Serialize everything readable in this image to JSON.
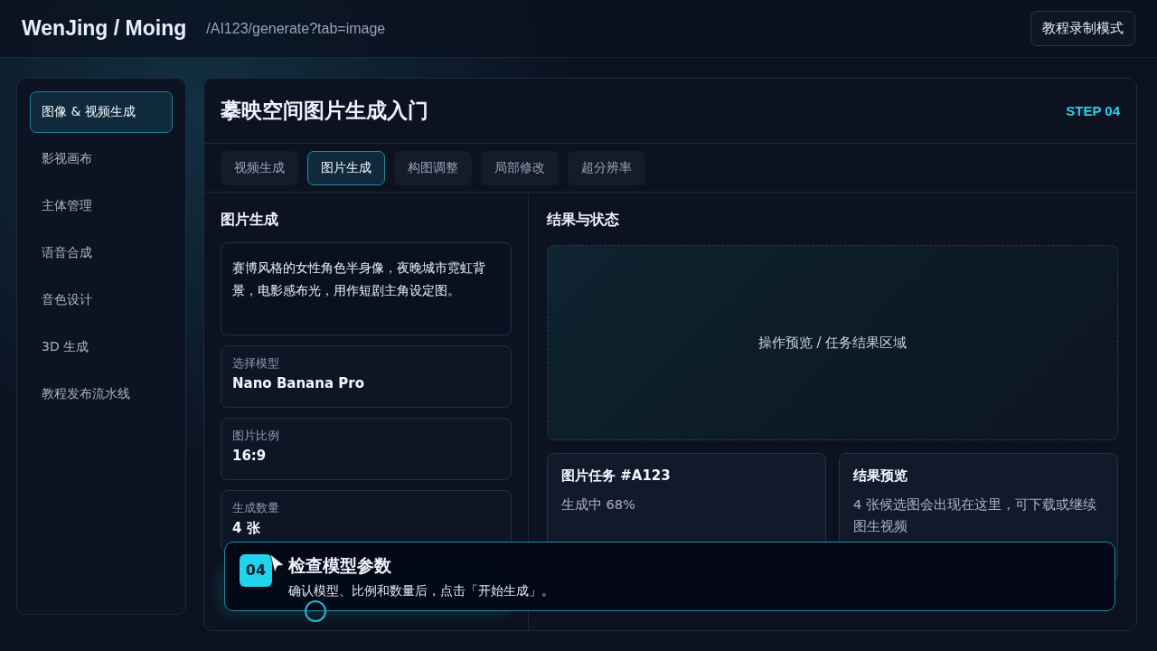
{
  "header": {
    "brand": "WenJing / Moing",
    "path": "/AI123/generate?tab=image",
    "mode_button": "教程录制模式"
  },
  "sidebar": {
    "items": [
      {
        "label": "图像 & 视频生成",
        "selected": true
      },
      {
        "label": "影视画布",
        "selected": false
      },
      {
        "label": "主体管理",
        "selected": false
      },
      {
        "label": "语音合成",
        "selected": false
      },
      {
        "label": "音色设计",
        "selected": false
      },
      {
        "label": "3D 生成",
        "selected": false
      },
      {
        "label": "教程发布流水线",
        "selected": false
      }
    ]
  },
  "page": {
    "title": "摹映空间图片生成入门",
    "step": "STEP 04"
  },
  "tabs": [
    {
      "label": "视频生成",
      "selected": false
    },
    {
      "label": "图片生成",
      "selected": true
    },
    {
      "label": "构图调整",
      "selected": false
    },
    {
      "label": "局部修改",
      "selected": false
    },
    {
      "label": "超分辨率",
      "selected": false
    }
  ],
  "form": {
    "title": "图片生成",
    "prompt": "赛博风格的女性角色半身像，夜晚城市霓虹背景，电影感布光，用作短剧主角设定图。",
    "fields": [
      {
        "label": "选择模型",
        "value": "Nano Banana Pro"
      },
      {
        "label": "图片比例",
        "value": "16:9"
      },
      {
        "label": "生成数量",
        "value": "4 张"
      }
    ]
  },
  "results": {
    "title": "结果与状态",
    "preview": "操作预览 / 任务结果区域",
    "cards": [
      {
        "title": "图片任务 #A123",
        "text": "生成中 68%"
      },
      {
        "title": "结果预览",
        "text": "4 张候选图会出现在这里，可下载或继续图生视频"
      }
    ]
  },
  "callout": {
    "number": "04",
    "title": "检查模型参数",
    "text": "确认模型、比例和数量后，点击「开始生成」。"
  }
}
